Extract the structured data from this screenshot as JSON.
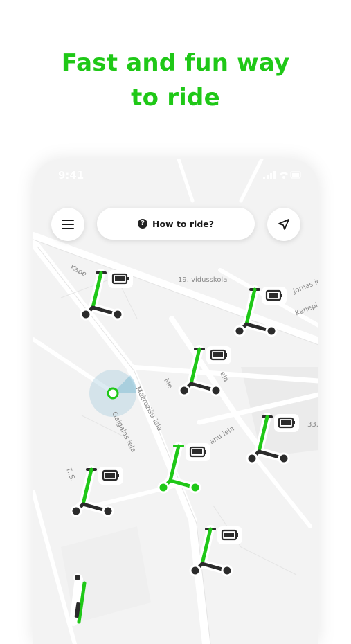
{
  "headline": {
    "line1": "Fast and fun way",
    "line2": "to ride"
  },
  "status_bar": {
    "time": "9:41"
  },
  "buttons": {
    "menu_icon": "hamburger-menu-icon",
    "how_to_ride_label": "How to ride?",
    "help_icon": "question-circle-icon",
    "location_icon": "navigation-arrow-icon"
  },
  "map_labels": {
    "kape": "Kape",
    "school": "19. vidusskola",
    "jomas": "Jomas ie",
    "kanepi": "Kanepi",
    "mez": "Mežrozīšu iela",
    "me": "Me",
    "ela": "ela",
    "gaigalas": "Gaigalas iela",
    "anu": "anu iela",
    "n33": "33.",
    "tl": "T..S."
  },
  "colors": {
    "brand_green": "#1fc817",
    "scooter_dark": "#2b2b2b",
    "map_background": "#f3f3f3",
    "road": "#ffffff"
  }
}
